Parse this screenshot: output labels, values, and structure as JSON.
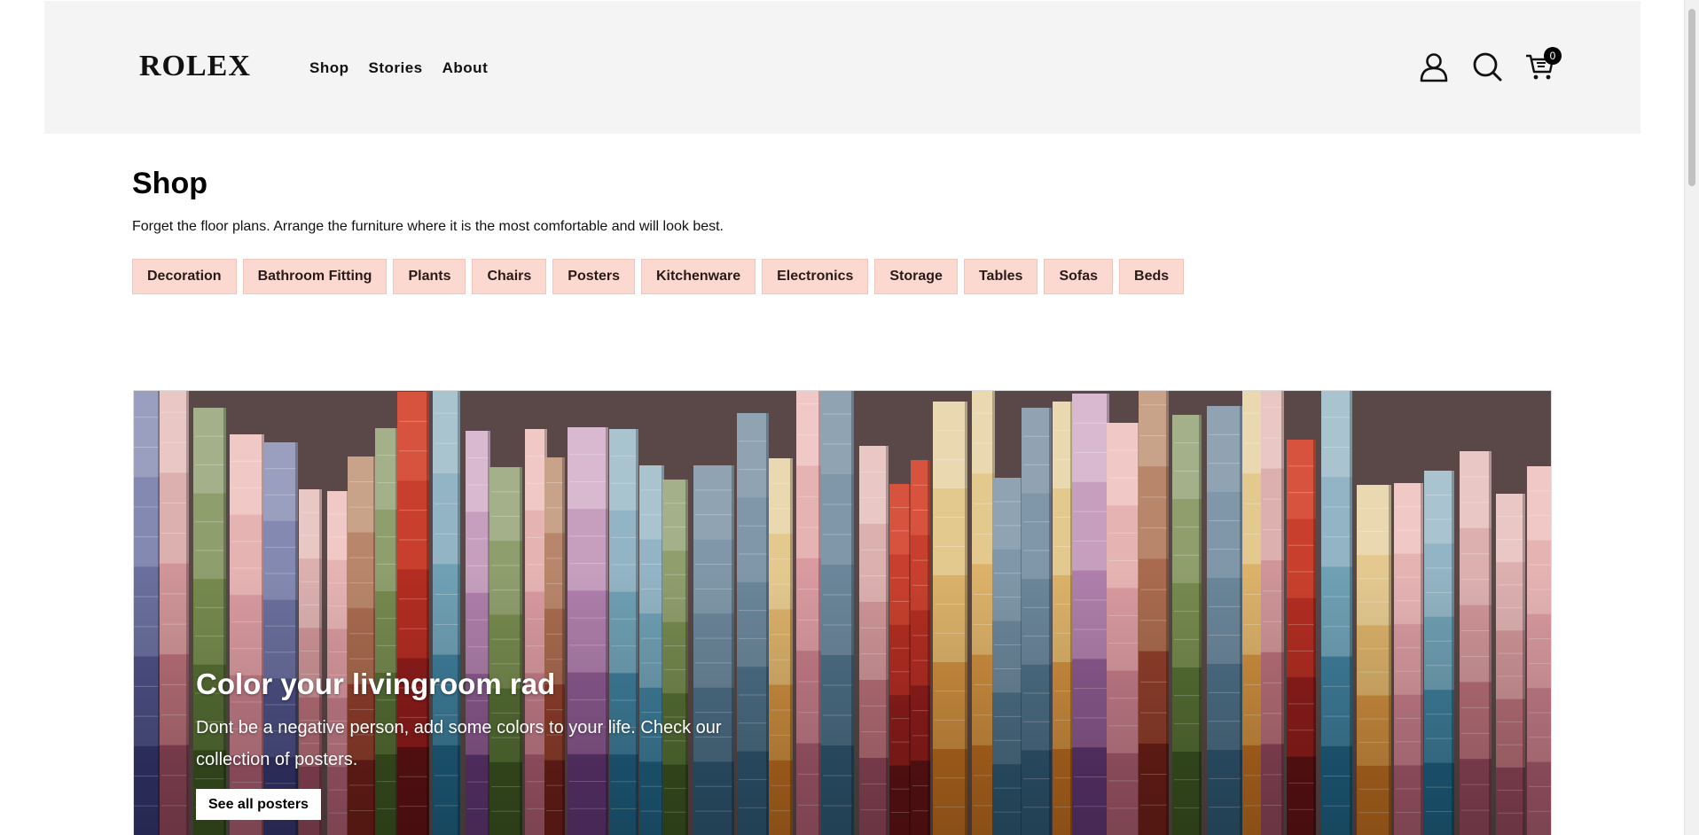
{
  "header": {
    "logo": "ROLEX",
    "nav": [
      "Shop",
      "Stories",
      "About"
    ],
    "cart_count": "0",
    "icons": [
      "user-icon",
      "search-icon",
      "cart-icon"
    ]
  },
  "shop": {
    "title": "Shop",
    "description": "Forget the floor plans. Arrange the furniture where it is the most comfortable and will look best.",
    "categories": [
      "Decoration",
      "Bathroom Fitting",
      "Plants",
      "Chairs",
      "Posters",
      "Kitchenware",
      "Electronics",
      "Storage",
      "Tables",
      "Sofas",
      "Beds"
    ]
  },
  "hero": {
    "title": "Color your livingroom rad",
    "text": "Dont be a negative person, add some colors to your life. Check our collection of posters.",
    "button_label": "See all posters"
  },
  "colors": {
    "header_bg": "#f4f4f4",
    "chip_bg": "#fbd9d0"
  }
}
